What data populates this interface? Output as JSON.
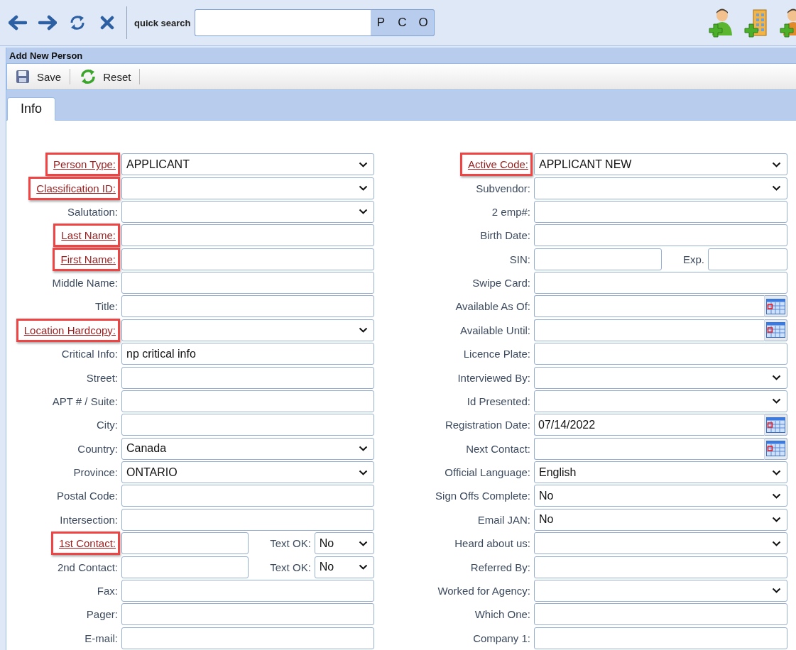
{
  "quick_search": {
    "label": "quick search",
    "buttons": [
      "P",
      "C",
      "O"
    ]
  },
  "panel": {
    "title": "Add New Person",
    "actions": [
      {
        "kind": "save",
        "label": "Save"
      },
      {
        "kind": "reset",
        "label": "Reset"
      }
    ],
    "tabs": [
      {
        "label": "Info",
        "selected": true
      }
    ]
  },
  "form": {
    "left": [
      {
        "label": "Person Type:",
        "kind": "select",
        "value": "APPLICANT",
        "required": true,
        "highlighted": true
      },
      {
        "label": "Classification ID:",
        "kind": "select",
        "required": true,
        "highlighted": true
      },
      {
        "label": "Salutation:",
        "kind": "select",
        "required": false,
        "highlighted": false
      },
      {
        "label": "Last Name:",
        "kind": "text",
        "required": true,
        "highlighted": true
      },
      {
        "label": "First Name:",
        "kind": "text",
        "required": true,
        "highlighted": true
      },
      {
        "label": "Middle Name:",
        "kind": "text",
        "required": false,
        "highlighted": false
      },
      {
        "label": "Title:",
        "kind": "text",
        "required": false,
        "highlighted": false
      },
      {
        "label": "Location Hardcopy:",
        "kind": "select",
        "required": true,
        "highlighted": true
      },
      {
        "label": "Critical Info:",
        "kind": "text",
        "value": "np critical info",
        "required": false,
        "highlighted": false
      },
      {
        "label": "Street:",
        "kind": "text",
        "required": false,
        "highlighted": false
      },
      {
        "label": "APT # / Suite:",
        "kind": "text",
        "required": false,
        "highlighted": false
      },
      {
        "label": "City:",
        "kind": "text",
        "required": false,
        "highlighted": false
      },
      {
        "label": "Country:",
        "kind": "select",
        "value": "Canada",
        "required": false,
        "highlighted": false
      },
      {
        "label": "Province:",
        "kind": "select",
        "value": "ONTARIO",
        "required": false,
        "highlighted": false
      },
      {
        "label": "Postal Code:",
        "kind": "text",
        "required": false,
        "highlighted": false
      },
      {
        "label": "Intersection:",
        "kind": "text",
        "required": false,
        "highlighted": false
      },
      {
        "label": "1st Contact:",
        "kind": "pair",
        "required": true,
        "highlighted": true,
        "extra": {
          "label": "Text OK:",
          "kind": "select",
          "value": "No"
        }
      },
      {
        "label": "2nd Contact:",
        "kind": "pair",
        "required": false,
        "highlighted": false,
        "extra": {
          "label": "Text OK:",
          "kind": "select",
          "value": "No"
        }
      },
      {
        "label": "Fax:",
        "kind": "text",
        "required": false,
        "highlighted": false
      },
      {
        "label": "Pager:",
        "kind": "text",
        "required": false,
        "highlighted": false
      },
      {
        "label": "E-mail:",
        "kind": "text",
        "required": false,
        "highlighted": false
      }
    ],
    "right": [
      {
        "label": "Active Code:",
        "kind": "select",
        "value": "APPLICANT NEW",
        "required": true,
        "highlighted": true
      },
      {
        "label": "Subvendor:",
        "kind": "select",
        "required": false,
        "highlighted": false
      },
      {
        "label": "2 emp#:",
        "kind": "text",
        "required": false,
        "highlighted": false
      },
      {
        "label": "Birth Date:",
        "kind": "text",
        "required": false,
        "highlighted": false
      },
      {
        "label": "SIN:",
        "kind": "pair",
        "required": false,
        "highlighted": false,
        "extra": {
          "label": "Exp.",
          "kind": "text"
        }
      },
      {
        "label": "Swipe Card:",
        "kind": "text",
        "required": false,
        "highlighted": false
      },
      {
        "label": "Available As Of:",
        "kind": "date",
        "required": false,
        "highlighted": false
      },
      {
        "label": "Available Until:",
        "kind": "date",
        "required": false,
        "highlighted": false
      },
      {
        "label": "Licence Plate:",
        "kind": "text",
        "required": false,
        "highlighted": false
      },
      {
        "label": "Interviewed By:",
        "kind": "select",
        "required": false,
        "highlighted": false
      },
      {
        "label": "Id Presented:",
        "kind": "select",
        "required": false,
        "highlighted": false
      },
      {
        "label": "Registration Date:",
        "kind": "date",
        "value": "07/14/2022",
        "required": false,
        "highlighted": false
      },
      {
        "label": "Next Contact:",
        "kind": "date",
        "required": false,
        "highlighted": false
      },
      {
        "label": "Official Language:",
        "kind": "select",
        "value": "English",
        "required": false,
        "highlighted": false
      },
      {
        "label": "Sign Offs Complete:",
        "kind": "select",
        "value": "No",
        "required": false,
        "highlighted": false
      },
      {
        "label": "Email JAN:",
        "kind": "select",
        "value": "No",
        "required": false,
        "highlighted": false
      },
      {
        "label": "Heard about us:",
        "kind": "select",
        "required": false,
        "highlighted": false
      },
      {
        "label": "Referred By:",
        "kind": "text",
        "required": false,
        "highlighted": false
      },
      {
        "label": "Worked for Agency:",
        "kind": "select",
        "required": false,
        "highlighted": false
      },
      {
        "label": "Which One:",
        "kind": "text",
        "required": false,
        "highlighted": false
      },
      {
        "label": "Company 1:",
        "kind": "text",
        "required": false,
        "highlighted": false
      }
    ]
  }
}
